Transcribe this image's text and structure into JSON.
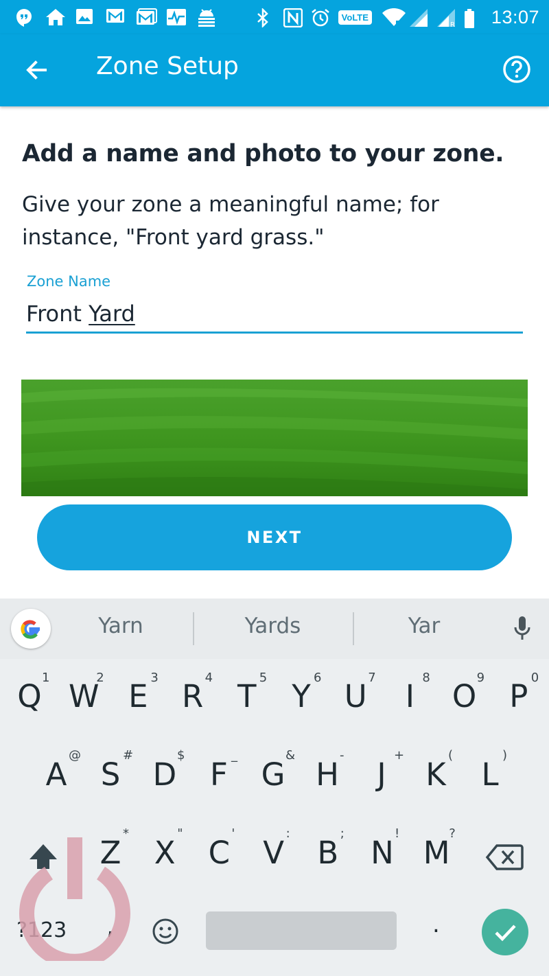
{
  "status_bar": {
    "volte": "VoLTE",
    "time": "13:07"
  },
  "app_bar": {
    "title": "Zone Setup"
  },
  "content": {
    "heading": "Add a name and photo to your zone.",
    "description": "Give your zone a meaningful name; for instance, \"Front yard grass.\"",
    "field_label": "Zone Name",
    "field_value_plain": "Front ",
    "field_value_underlined": "Yard",
    "next_label": "NEXT"
  },
  "keyboard": {
    "suggestions": [
      "Yarn",
      "Yards",
      "Yar"
    ],
    "row1": [
      {
        "key": "Q",
        "hint": "1"
      },
      {
        "key": "W",
        "hint": "2"
      },
      {
        "key": "E",
        "hint": "3"
      },
      {
        "key": "R",
        "hint": "4"
      },
      {
        "key": "T",
        "hint": "5"
      },
      {
        "key": "Y",
        "hint": "6"
      },
      {
        "key": "U",
        "hint": "7"
      },
      {
        "key": "I",
        "hint": "8"
      },
      {
        "key": "O",
        "hint": "9"
      },
      {
        "key": "P",
        "hint": "0"
      }
    ],
    "row2": [
      {
        "key": "A",
        "hint": "@"
      },
      {
        "key": "S",
        "hint": "#"
      },
      {
        "key": "D",
        "hint": "$"
      },
      {
        "key": "F",
        "hint": "_"
      },
      {
        "key": "G",
        "hint": "&"
      },
      {
        "key": "H",
        "hint": "-"
      },
      {
        "key": "J",
        "hint": "+"
      },
      {
        "key": "K",
        "hint": "("
      },
      {
        "key": "L",
        "hint": ")"
      }
    ],
    "row3": [
      {
        "key": "Z",
        "hint": "*"
      },
      {
        "key": "X",
        "hint": "\""
      },
      {
        "key": "C",
        "hint": "'"
      },
      {
        "key": "V",
        "hint": ":"
      },
      {
        "key": "B",
        "hint": ";"
      },
      {
        "key": "N",
        "hint": "!"
      },
      {
        "key": "M",
        "hint": "?"
      }
    ],
    "symbols_label": "?123",
    "comma_label": ",",
    "period_label": "."
  },
  "colors": {
    "primary": "#05a4de",
    "button": "#16a3dd",
    "heading_text": "#1b2733",
    "field_accent": "#1aa0d3",
    "keyboard_bg": "#eceff1",
    "enter_key": "#45b39e",
    "watermark": "#d9a0ad"
  },
  "icons": {
    "status_left": [
      "hangouts-icon",
      "home-icon",
      "image-icon",
      "gmail-icon",
      "gmail-icon",
      "activity-icon",
      "android-debug-icon"
    ],
    "status_right": [
      "bluetooth-icon",
      "nfc-icon",
      "alarm-icon",
      "volte-icon",
      "wifi-icon",
      "signal-icon",
      "signal-roaming-icon",
      "battery-icon"
    ]
  }
}
